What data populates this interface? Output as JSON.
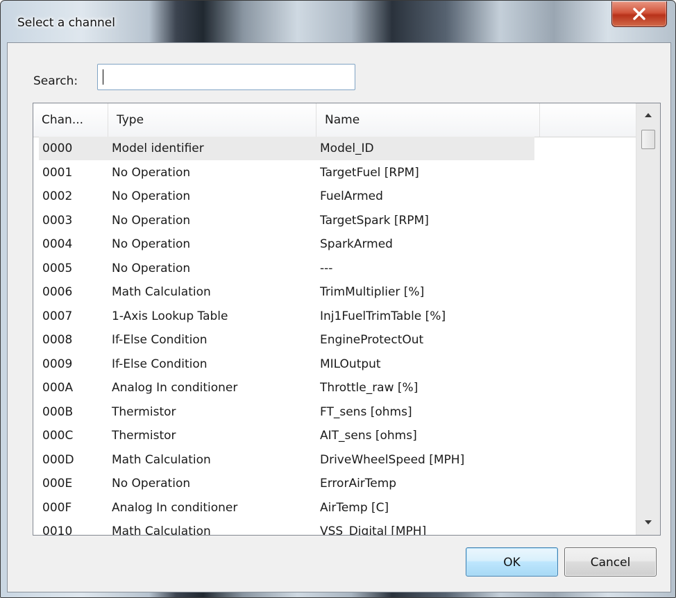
{
  "window": {
    "title": "Select a channel",
    "close_icon": "close-icon"
  },
  "search": {
    "label": "Search:",
    "value": "",
    "placeholder": ""
  },
  "list": {
    "columns": [
      "Chan...",
      "Type",
      "Name"
    ],
    "rows": [
      {
        "chan": "0000",
        "type": "Model identifier",
        "name": "Model_ID"
      },
      {
        "chan": "0001",
        "type": "No Operation",
        "name": "TargetFuel [RPM]"
      },
      {
        "chan": "0002",
        "type": "No Operation",
        "name": "FuelArmed"
      },
      {
        "chan": "0003",
        "type": "No Operation",
        "name": "TargetSpark [RPM]"
      },
      {
        "chan": "0004",
        "type": "No Operation",
        "name": "SparkArmed"
      },
      {
        "chan": "0005",
        "type": "No Operation",
        "name": "---"
      },
      {
        "chan": "0006",
        "type": "Math Calculation",
        "name": "TrimMultiplier [%]"
      },
      {
        "chan": "0007",
        "type": "1-Axis Lookup Table",
        "name": "Inj1FuelTrimTable [%]"
      },
      {
        "chan": "0008",
        "type": "If-Else Condition",
        "name": "EngineProtectOut"
      },
      {
        "chan": "0009",
        "type": "If-Else Condition",
        "name": "MILOutput"
      },
      {
        "chan": "000A",
        "type": "Analog In conditioner",
        "name": "Throttle_raw [%]"
      },
      {
        "chan": "000B",
        "type": "Thermistor",
        "name": "FT_sens [ohms]"
      },
      {
        "chan": "000C",
        "type": "Thermistor",
        "name": "AIT_sens [ohms]"
      },
      {
        "chan": "000D",
        "type": "Math Calculation",
        "name": "DriveWheelSpeed [MPH]"
      },
      {
        "chan": "000E",
        "type": "No Operation",
        "name": "ErrorAirTemp"
      },
      {
        "chan": "000F",
        "type": "Analog In conditioner",
        "name": "AirTemp [C]"
      },
      {
        "chan": "0010",
        "type": "Math Calculation",
        "name": "VSS_Digital [MPH]"
      }
    ]
  },
  "buttons": {
    "ok": "OK",
    "cancel": "Cancel"
  }
}
